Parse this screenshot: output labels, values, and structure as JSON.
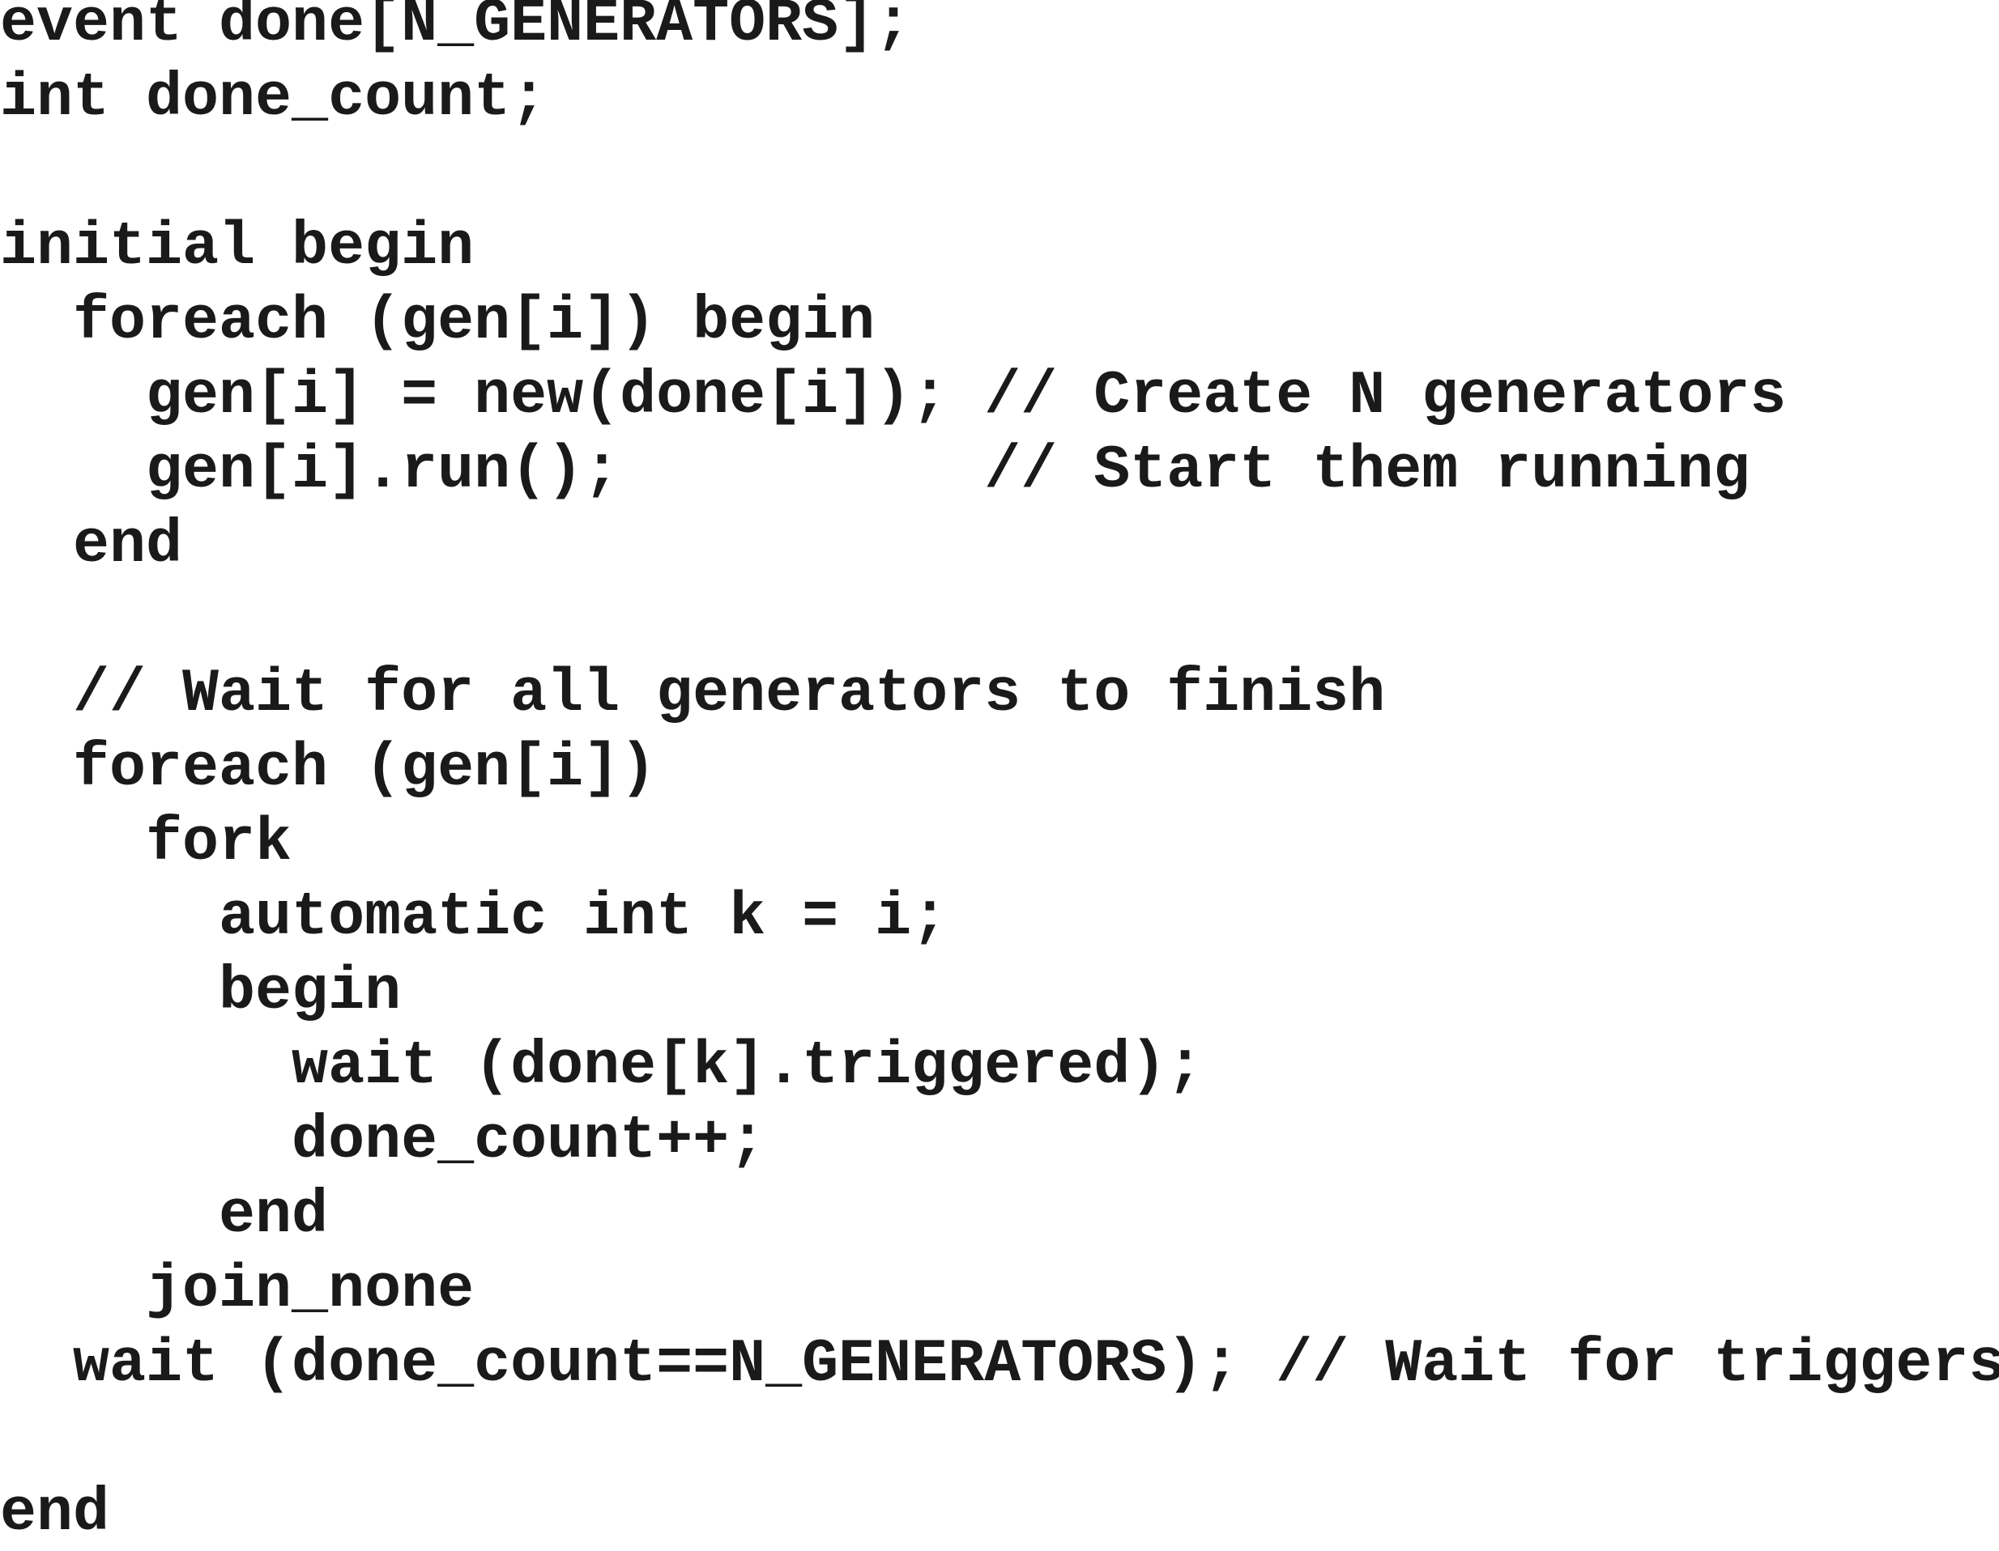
{
  "code": {
    "lines": [
      "event done[N_GENERATORS];",
      "int done_count;",
      "",
      "initial begin",
      "  foreach (gen[i]) begin",
      "    gen[i] = new(done[i]); // Create N generators",
      "    gen[i].run();          // Start them running",
      "  end",
      "",
      "  // Wait for all generators to finish",
      "  foreach (gen[i])",
      "    fork",
      "      automatic int k = i;",
      "      begin",
      "        wait (done[k].triggered);",
      "        done_count++;",
      "      end",
      "    join_none",
      "  wait (done_count==N_GENERATORS); // Wait for triggers",
      "",
      "end"
    ]
  }
}
